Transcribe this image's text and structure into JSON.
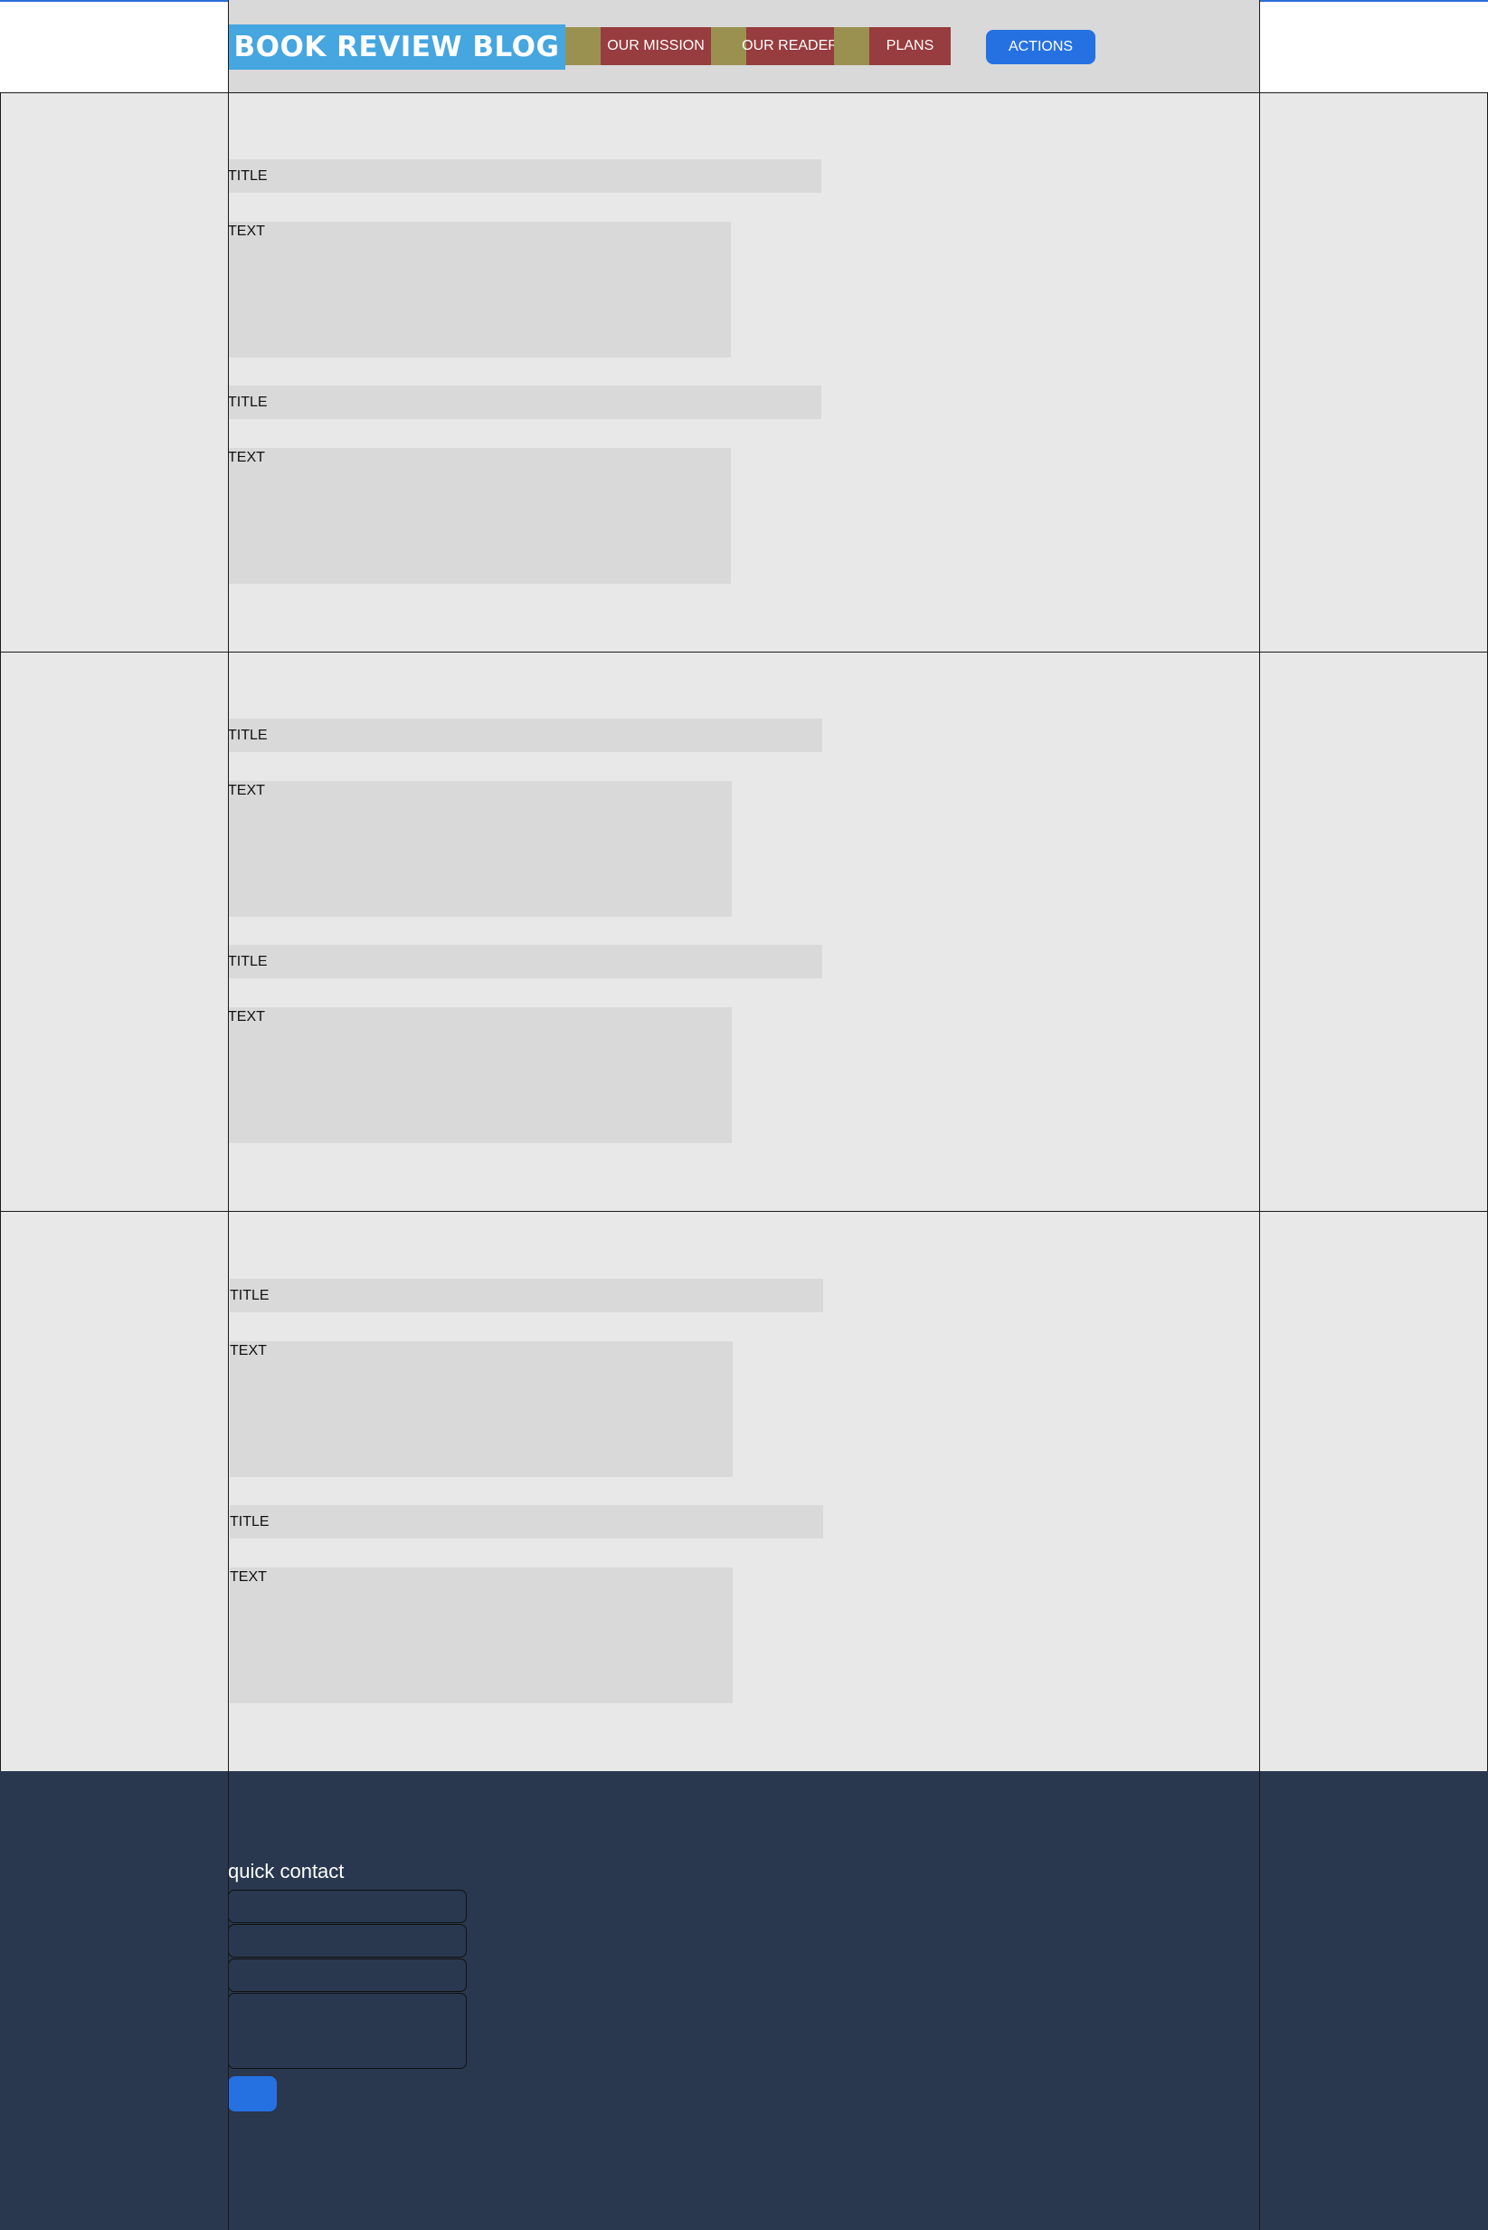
{
  "header": {
    "logo": "BOOK REVIEW BLOG",
    "nav": [
      "OUR MISSION",
      "OUR READER",
      "PLANS"
    ],
    "actions_label": "ACTIONS"
  },
  "sections": [
    {
      "posts": [
        {
          "title": "TITLE",
          "text": "TEXT"
        },
        {
          "title": "TITLE",
          "text": "TEXT"
        }
      ]
    },
    {
      "posts": [
        {
          "title": "TITLE",
          "text": "TEXT"
        },
        {
          "title": "TITLE",
          "text": "TEXT"
        }
      ]
    },
    {
      "posts": [
        {
          "title": "TITLE",
          "text": "TEXT"
        },
        {
          "title": "TITLE",
          "text": "TEXT"
        }
      ]
    }
  ],
  "footer": {
    "quick_contact_label": "quick contact"
  },
  "colors": {
    "accent_blue": "#2671e2",
    "logo_blue": "#45a6e0",
    "nav_red": "#973c3f",
    "nav_olive": "#9a9150",
    "footer_navy": "#29384f"
  }
}
